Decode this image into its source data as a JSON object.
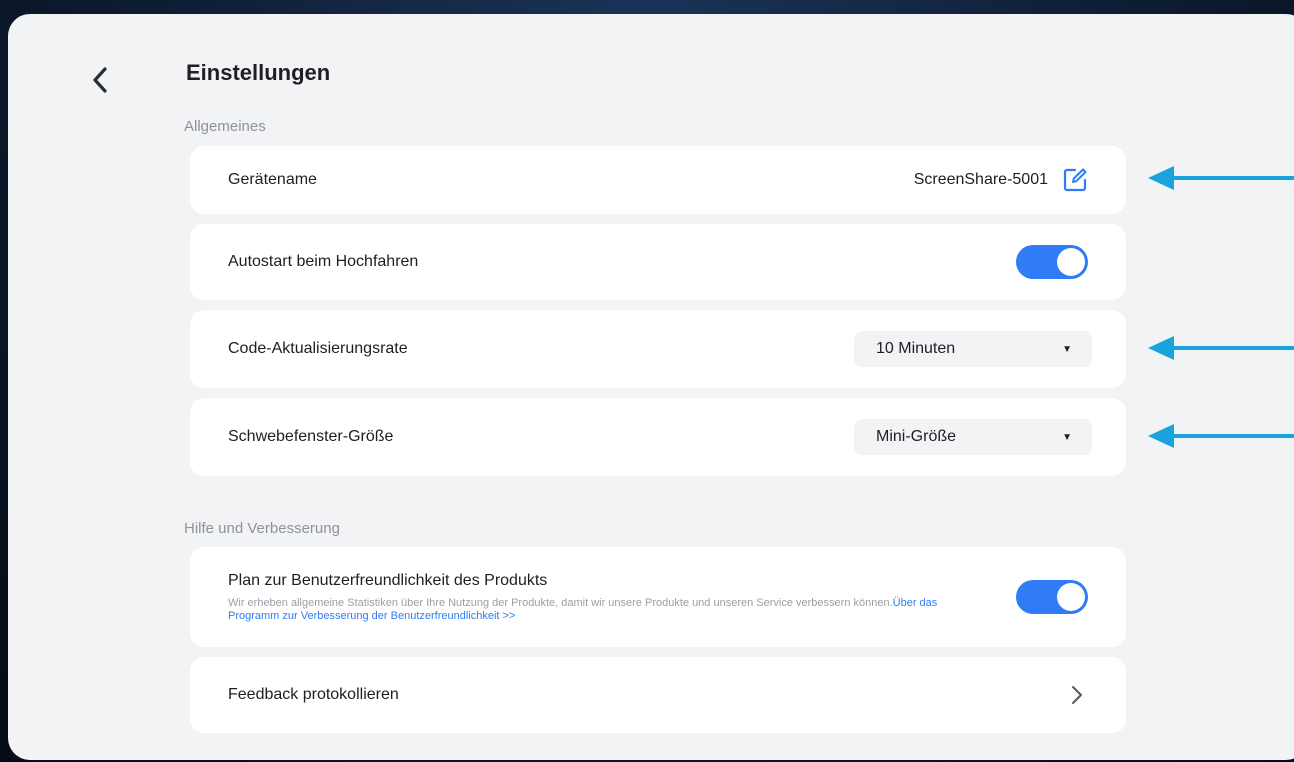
{
  "page": {
    "title": "Einstellungen"
  },
  "sections": {
    "general_label": "Allgemeines",
    "help_label": "Hilfe und Verbesserung"
  },
  "device_name": {
    "label": "Gerätename",
    "value": "ScreenShare-5001",
    "edit_icon": "edit-icon"
  },
  "autostart": {
    "label": "Autostart beim Hochfahren",
    "enabled": true
  },
  "code_refresh": {
    "label": "Code-Aktualisierungsrate",
    "selected": "10 Minuten"
  },
  "float_window": {
    "label": "Schwebefenster-Größe",
    "selected": "Mini-Größe"
  },
  "usability_plan": {
    "title": "Plan zur Benutzerfreundlichkeit des Produkts",
    "description": "Wir erheben allgemeine Statistiken über Ihre Nutzung der Produkte, damit wir unsere Produkte und unseren Service verbessern können.",
    "link_text": "Über das Programm zur Verbesserung der Benutzerfreundlichkeit >>",
    "enabled": true
  },
  "feedback": {
    "label": "Feedback protokollieren"
  },
  "colors": {
    "accent": "#2f7cf6",
    "annotation_arrow": "#1aa3dc",
    "panel_bg": "#f2f3f5",
    "card_bg": "#ffffff"
  }
}
